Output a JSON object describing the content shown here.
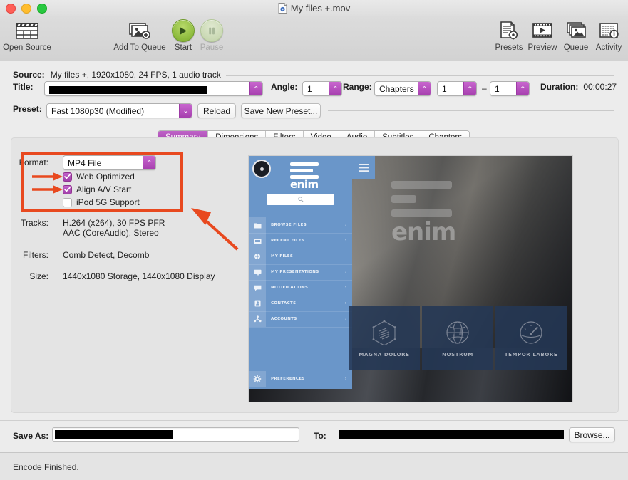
{
  "window": {
    "title": "My files +.mov",
    "doc_icon": "mov-file-icon",
    "traffic_lights": [
      "close",
      "minimize",
      "zoom"
    ]
  },
  "toolbar": {
    "items": [
      {
        "label": "Open Source",
        "icon": "clapperboard-icon",
        "enabled": true
      },
      {
        "label": "Add To Queue",
        "icon": "add-images-icon",
        "enabled": true
      },
      {
        "label": "Start",
        "icon": "play-icon",
        "enabled": true
      },
      {
        "label": "Pause",
        "icon": "pause-icon",
        "enabled": false
      },
      {
        "label": "Presets",
        "icon": "presets-gear-icon",
        "enabled": true
      },
      {
        "label": "Preview",
        "icon": "film-play-icon",
        "enabled": true
      },
      {
        "label": "Queue",
        "icon": "stacked-images-icon",
        "enabled": true
      },
      {
        "label": "Activity",
        "icon": "activity-log-icon",
        "enabled": true
      }
    ]
  },
  "source": {
    "label": "Source:",
    "value": "My files +, 1920x1080, 24 FPS, 1 audio track"
  },
  "title_row": {
    "label": "Title:",
    "value": "",
    "redacted": true,
    "angle_label": "Angle:",
    "angle_value": "1",
    "range_label": "Range:",
    "range_type": "Chapters",
    "range_start": "1",
    "range_dash": "–",
    "range_end": "1",
    "duration_label": "Duration:",
    "duration_value": "00:00:27"
  },
  "preset_row": {
    "label": "Preset:",
    "value": "Fast 1080p30 (Modified)",
    "reload_label": "Reload",
    "save_label": "Save New Preset..."
  },
  "tabs": [
    {
      "label": "Summary",
      "active": true
    },
    {
      "label": "Dimensions",
      "active": false
    },
    {
      "label": "Filters",
      "active": false
    },
    {
      "label": "Video",
      "active": false
    },
    {
      "label": "Audio",
      "active": false
    },
    {
      "label": "Subtitles",
      "active": false
    },
    {
      "label": "Chapters",
      "active": false
    }
  ],
  "summary": {
    "format_label": "Format:",
    "format_value": "MP4 File",
    "checkboxes": [
      {
        "label": "Web Optimized",
        "checked": true
      },
      {
        "label": "Align A/V Start",
        "checked": true
      },
      {
        "label": "iPod 5G Support",
        "checked": false
      }
    ],
    "tracks_label": "Tracks:",
    "tracks_line1": "H.264 (x264), 30 FPS PFR",
    "tracks_line2": "AAC (CoreAudio), Stereo",
    "filters_label": "Filters:",
    "filters_value": "Comb Detect, Decomb",
    "size_label": "Size:",
    "size_value": "1440x1080 Storage, 1440x1080 Display"
  },
  "preview": {
    "brand": "enim",
    "hero_word": "enim",
    "search_placeholder": "",
    "menu_items": [
      {
        "label": "BROWSE FILES",
        "icon": "folder-icon",
        "has_chevron": true
      },
      {
        "label": "RECENT FILES",
        "icon": "recent-files-icon",
        "has_chevron": true
      },
      {
        "label": "MY FILES",
        "icon": "my-files-icon",
        "has_chevron": false
      },
      {
        "label": "MY PRESENTATIONS",
        "icon": "monitor-icon",
        "has_chevron": true
      },
      {
        "label": "NOTIFICATIONS",
        "icon": "chat-icon",
        "has_chevron": true
      },
      {
        "label": "CONTACTS",
        "icon": "contact-card-icon",
        "has_chevron": true
      },
      {
        "label": "ACCOUNTS",
        "icon": "accounts-icon",
        "has_chevron": true
      }
    ],
    "preferences": {
      "label": "PREFERENCES",
      "icon": "gear-icon",
      "has_chevron": true
    },
    "cards": [
      {
        "label": "MAGNA DOLORE",
        "icon": "hexagon-icon"
      },
      {
        "label": "NOSTRUM",
        "icon": "globe-icon"
      },
      {
        "label": "TEMPOR LABORE",
        "icon": "gauge-icon"
      }
    ]
  },
  "bottom": {
    "save_as_label": "Save As:",
    "save_as_value": "",
    "to_label": "To:",
    "to_value": "",
    "browse_label": "Browse..."
  },
  "status": {
    "text": "Encode Finished."
  },
  "annotations": {
    "highlight_color": "#e8491f",
    "arrows": [
      "arrow-to-web-optimized",
      "arrow-to-align-av-start",
      "arrow-to-format-box"
    ]
  },
  "colors": {
    "accent_purple": "#a63fae",
    "annotation_red": "#e8491f",
    "start_green": "#8cba3c",
    "sidebar_blue": "#6a96c9"
  }
}
